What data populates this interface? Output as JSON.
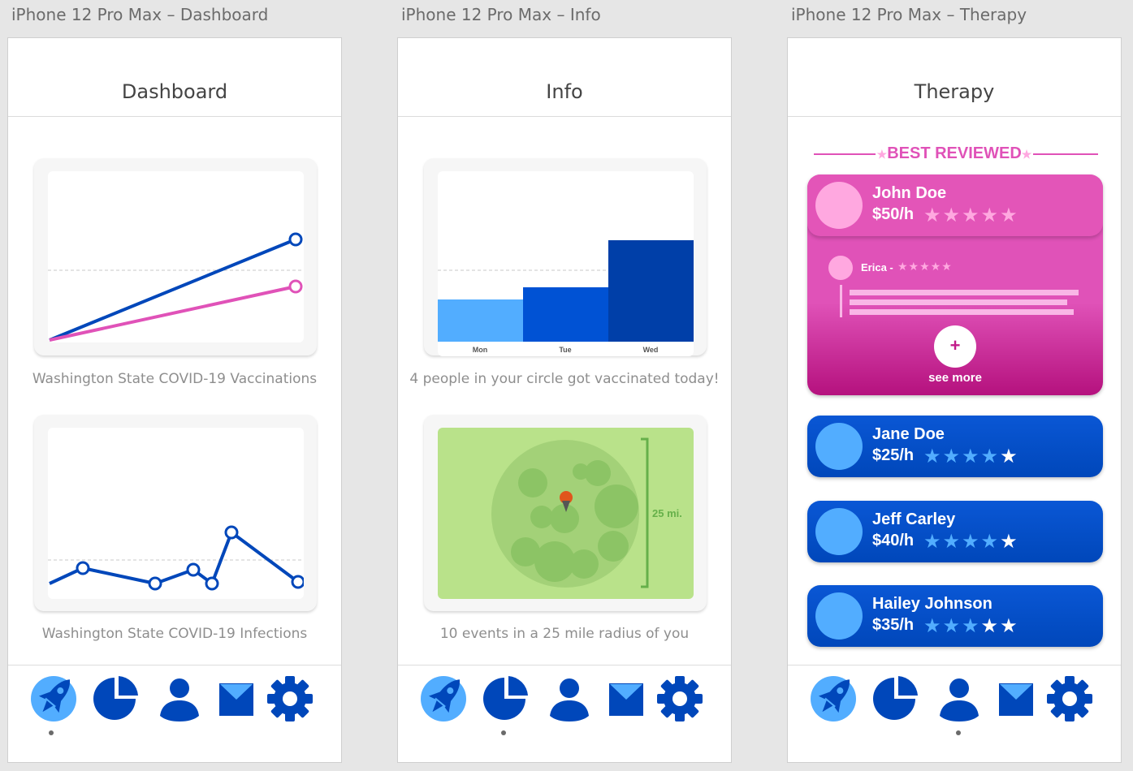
{
  "artboards": [
    {
      "label": "iPhone 12 Pro Max – Dashboard",
      "title": "Dashboard"
    },
    {
      "label": "iPhone 12 Pro Max – Info",
      "title": "Info"
    },
    {
      "label": "iPhone 12 Pro Max – Therapy",
      "title": "Therapy"
    }
  ],
  "dashboard": {
    "vaccinations_caption": "Washington State COVID-19 Vaccinations",
    "infections_caption": "Washington State COVID-19 Infections"
  },
  "info": {
    "bar_days": [
      "Mon",
      "Tue",
      "Wed"
    ],
    "vaccinated_caption": "4 people in your circle got vaccinated today!",
    "map_radius_label": "25 mi.",
    "events_caption": "10 events in a 25 mile radius of you"
  },
  "therapy": {
    "best_reviewed": "BEST REVIEWED",
    "featured": {
      "name": "John Doe",
      "rate": "$50/h",
      "stars": "★★★★★",
      "review_name": "Erica -",
      "review_stars": "★★★★★",
      "plus": "+",
      "see_more": "see more"
    },
    "therapists": [
      {
        "name": "Jane Doe",
        "rate": "$25/h",
        "rating": 4
      },
      {
        "name": "Jeff Carley",
        "rate": "$40/h",
        "rating": 4
      },
      {
        "name": "Hailey Johnson",
        "rate": "$35/h",
        "rating": 3
      }
    ]
  },
  "colors": {
    "primary_blue": "#0047ba",
    "light_blue": "#52adff",
    "pink": "#e052b8",
    "map_green": "#b9e28a"
  },
  "tabbar": {
    "icons": [
      "rocket-icon",
      "pie-chart-icon",
      "user-icon",
      "mail-icon",
      "gear-icon"
    ]
  }
}
